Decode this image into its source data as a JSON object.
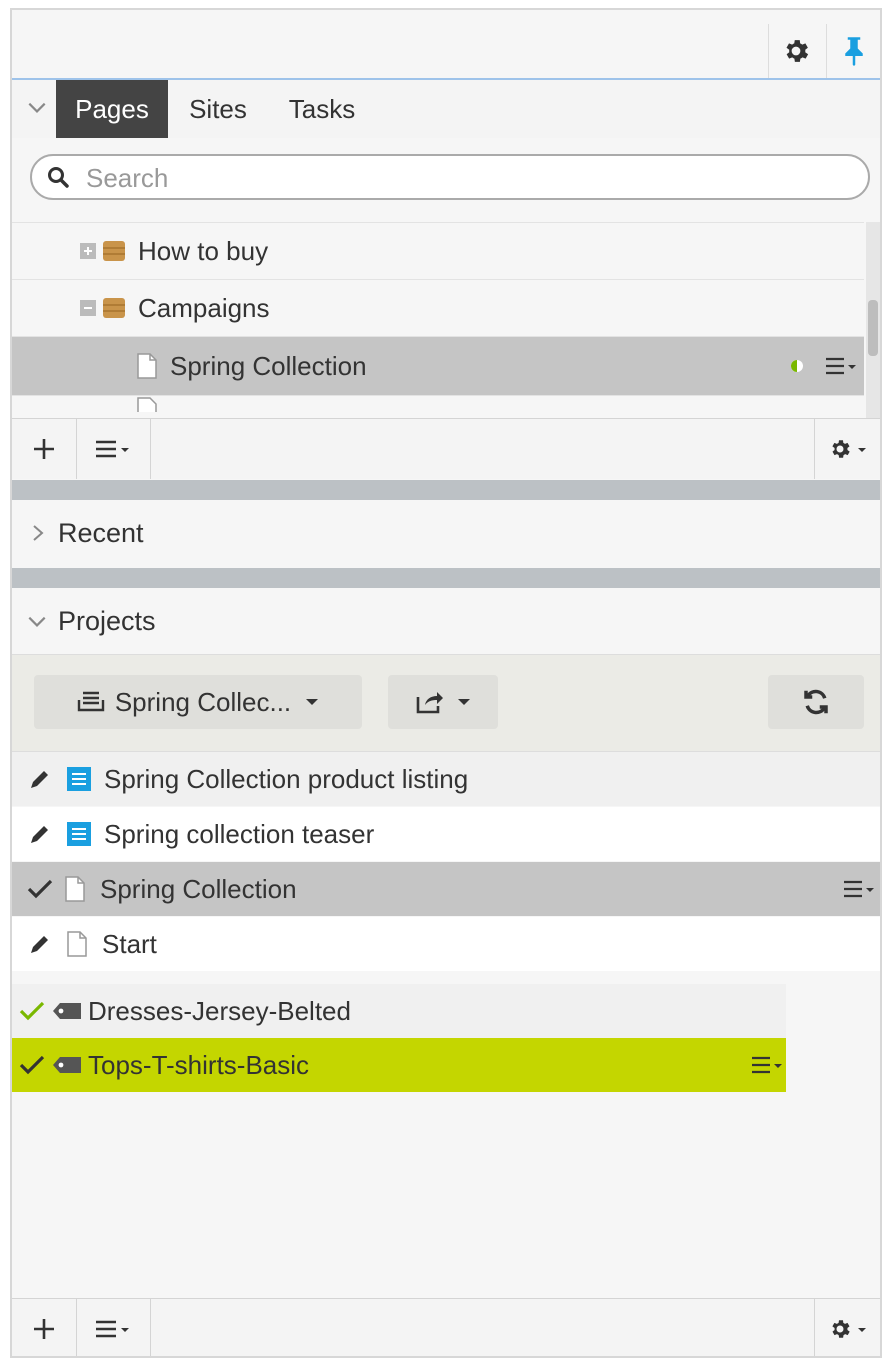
{
  "tabs": [
    "Pages",
    "Sites",
    "Tasks"
  ],
  "search": {
    "placeholder": "Search"
  },
  "tree": [
    {
      "label": "How to buy",
      "expander": "plus",
      "type": "folder"
    },
    {
      "label": "Campaigns",
      "expander": "minus",
      "type": "folder"
    },
    {
      "label": "Spring Collection",
      "type": "page",
      "selected": true
    }
  ],
  "recent": {
    "label": "Recent"
  },
  "projects": {
    "label": "Projects",
    "selector": "Spring Collec...",
    "items": [
      {
        "label": "Spring Collection product listing",
        "status": "pencil-icon",
        "type": "block"
      },
      {
        "label": "Spring collection teaser",
        "status": "pencil-icon",
        "type": "block"
      },
      {
        "label": "Spring Collection",
        "status": "check-icon",
        "type": "page"
      },
      {
        "label": "Start",
        "status": "pencil-icon",
        "type": "page"
      },
      {
        "label": "Dresses-Jersey-Belted",
        "status": "check-icon",
        "type": "tag"
      },
      {
        "label": "Tops-T-shirts-Basic",
        "status": "check-icon",
        "type": "tag"
      }
    ]
  },
  "colors": {
    "accent_lime": "#c4d600",
    "pin_blue": "#1a9fe0",
    "block_blue": "#1a9fe0",
    "check_green": "#7ab800"
  }
}
